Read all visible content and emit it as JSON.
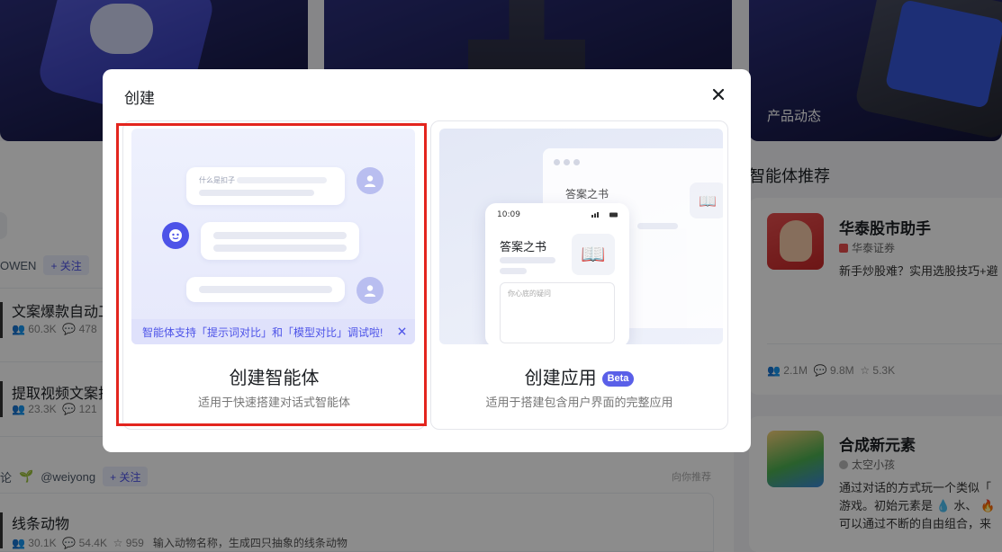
{
  "background": {
    "banners": [
      {
        "caption": ""
      },
      {
        "caption": ""
      },
      {
        "caption": "产品动态"
      }
    ],
    "author_row": {
      "name": "OWEN",
      "follow_label": "+ 关注"
    },
    "feed": [
      {
        "title": "文案爆款自动⼯",
        "users": "60.3K",
        "comments": "478"
      },
      {
        "title": "提取视频文案挂",
        "users": "23.3K",
        "comments": "121"
      },
      {
        "title": "线条动物",
        "users": "30.1K",
        "comments": "54.4K",
        "stars": "959",
        "desc": "输入动物名称，生成四只抽象的线条动物"
      }
    ],
    "author_row_2": {
      "prefix": "论",
      "name": "@weiyong",
      "follow_label": "+ 关注"
    },
    "recommend_tag": "向你推荐",
    "right_panel": {
      "title": "智能体推荐",
      "cards": [
        {
          "name": "华泰股市助手",
          "org": "华泰证券",
          "desc": "新手炒股难？实用选股技巧+避",
          "users": "2.1M",
          "comments": "9.8M",
          "stars": "5.3K"
        },
        {
          "name": "合成新元素",
          "org": "太空小孩",
          "desc_lines": [
            "通过对话的方式玩一个类似「",
            "游戏。初始元素是 💧 水、 🔥",
            "可以通过不断的自由组合，来"
          ]
        }
      ]
    }
  },
  "modal": {
    "title": "创建",
    "agent_option": {
      "label": "创建智能体",
      "description": "适用于快速搭建对话式智能体",
      "preview": {
        "bubble_text": "什么是扣子",
        "notice": "智能体支持「提示词对比」和「模型对比」调试啦!"
      }
    },
    "app_option": {
      "label": "创建应用",
      "badge": "Beta",
      "description": "适用于搭建包含用户界面的完整应用",
      "preview": {
        "window_title": "答案之书",
        "phone_time": "10:09",
        "phone_title": "答案之书",
        "input_placeholder": "你心底的疑问"
      }
    }
  },
  "colors": {
    "accent": "#4d53e8",
    "highlight": "#e3251e",
    "overlay": "rgba(0,0,0,0.45)"
  }
}
